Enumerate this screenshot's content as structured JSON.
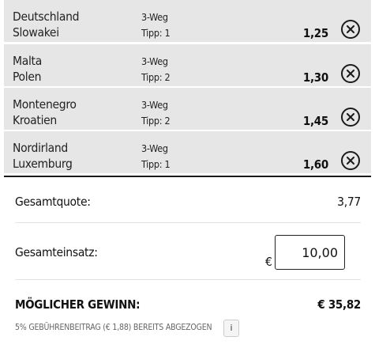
{
  "bets": [
    {
      "home": "Deutschland",
      "away": "Slowakei",
      "market": "3-Weg",
      "tip": "Tipp: 1",
      "odds": "1,25"
    },
    {
      "home": "Malta",
      "away": "Polen",
      "market": "3-Weg",
      "tip": "Tipp: 2",
      "odds": "1,30"
    },
    {
      "home": "Montenegro",
      "away": "Kroatien",
      "market": "3-Weg",
      "tip": "Tipp: 2",
      "odds": "1,45"
    },
    {
      "home": "Nordirland",
      "away": "Luxemburg",
      "market": "3-Weg",
      "tip": "Tipp: 1",
      "odds": "1,60"
    }
  ],
  "summary": {
    "total_odds_label": "Gesamtquote:",
    "total_odds_value": "3,77",
    "stake_label": "Gesamteinsatz:",
    "currency": "€",
    "stake_value": "10,00",
    "win_label": "MÖGLICHER GEWINN:",
    "win_value": "€ 35,82",
    "fee_note": "5% GEBÜHRENBEITRAG (€ 1,88) BEREITS ABGEZOGEN",
    "info_label": "i"
  },
  "icons": {
    "remove": "close-circle-icon"
  }
}
